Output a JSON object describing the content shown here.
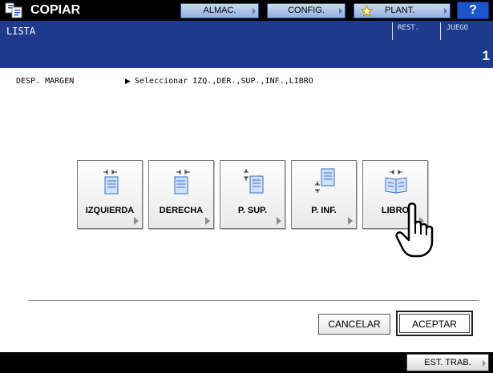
{
  "header": {
    "title": "COPIAR",
    "app_icon": "copier-icon",
    "buttons": {
      "almac": "ALMAC.",
      "config": "CONFIG.",
      "plant": "PLANT.",
      "help": "?"
    },
    "plant_icon": "star-icon",
    "colors": {
      "top_bar": "#000000",
      "button_blue": "#93afe0",
      "help_blue": "#1a56c9"
    }
  },
  "status": {
    "title": "LISTA",
    "rest_label": "REST.",
    "juego_label": "JUEGO",
    "juego_value": "1",
    "color": "#1e3a8a"
  },
  "instruction": {
    "label": "DESP. MARGEN",
    "arrow": "▶",
    "text": "Seleccionar IZQ.,DER.,SUP.,INF.,LIBRO"
  },
  "options": [
    {
      "label": "IZQUIERDA",
      "icon": "left-margin-shift-icon"
    },
    {
      "label": "DERECHA",
      "icon": "right-margin-shift-icon"
    },
    {
      "label": "P. SUP.",
      "icon": "top-margin-shift-icon"
    },
    {
      "label": "P. INF.",
      "icon": "bottom-margin-shift-icon"
    },
    {
      "label": "LIBRO",
      "icon": "book-margin-icon"
    }
  ],
  "footer": {
    "cancel": "CANCELAR",
    "accept": "ACEPTAR",
    "job_status": "EST. TRAB."
  }
}
